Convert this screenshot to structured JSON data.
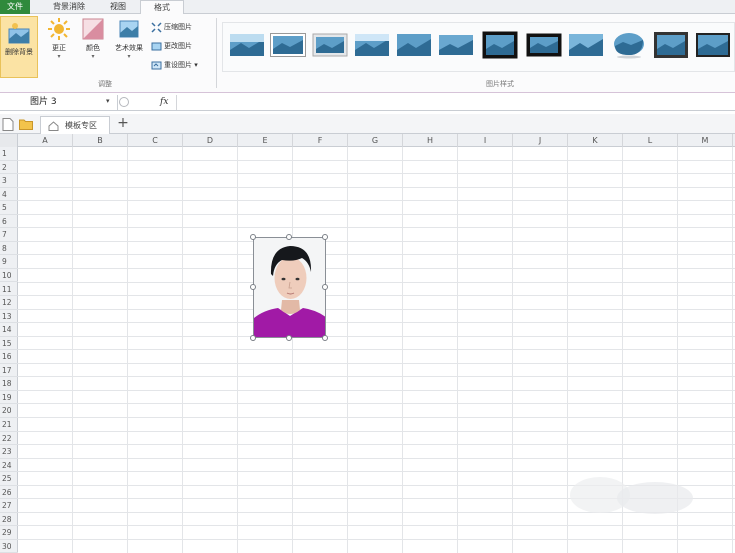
{
  "tabs": {
    "file": "文件",
    "background_removal": "背景消除",
    "view": "视图",
    "format": "格式"
  },
  "ribbon": {
    "remove_background": "删除背景",
    "correct": "更正",
    "color": "颜色",
    "artistic_effects": "艺术效果",
    "compress_picture": "压缩图片",
    "change_picture": "更改图片",
    "reset_picture": "重设图片",
    "adjust_group": "调整",
    "picture_styles_group": "图片样式"
  },
  "formula_bar": {
    "name_box": "图片 3",
    "fx": "fx",
    "value": ""
  },
  "doc_tabs": {
    "active_tab": "模板专区",
    "add": "+"
  },
  "sheet": {
    "columns": [
      "A",
      "B",
      "C",
      "D",
      "E",
      "F",
      "G",
      "H",
      "I",
      "J",
      "K",
      "L",
      "M"
    ],
    "rows": [
      "1",
      "2",
      "3",
      "4",
      "5",
      "6",
      "7",
      "8",
      "9",
      "10",
      "11",
      "12",
      "13",
      "14",
      "15",
      "16",
      "17",
      "18",
      "19",
      "20",
      "21",
      "22",
      "23",
      "24",
      "25",
      "26",
      "27",
      "28",
      "29",
      "30"
    ]
  },
  "colors": {
    "file_tab": "#2f8a3c",
    "selected_button": "#fbe3a4",
    "photo_shirt": "#a11aa6",
    "photo_hair": "#16181c"
  }
}
